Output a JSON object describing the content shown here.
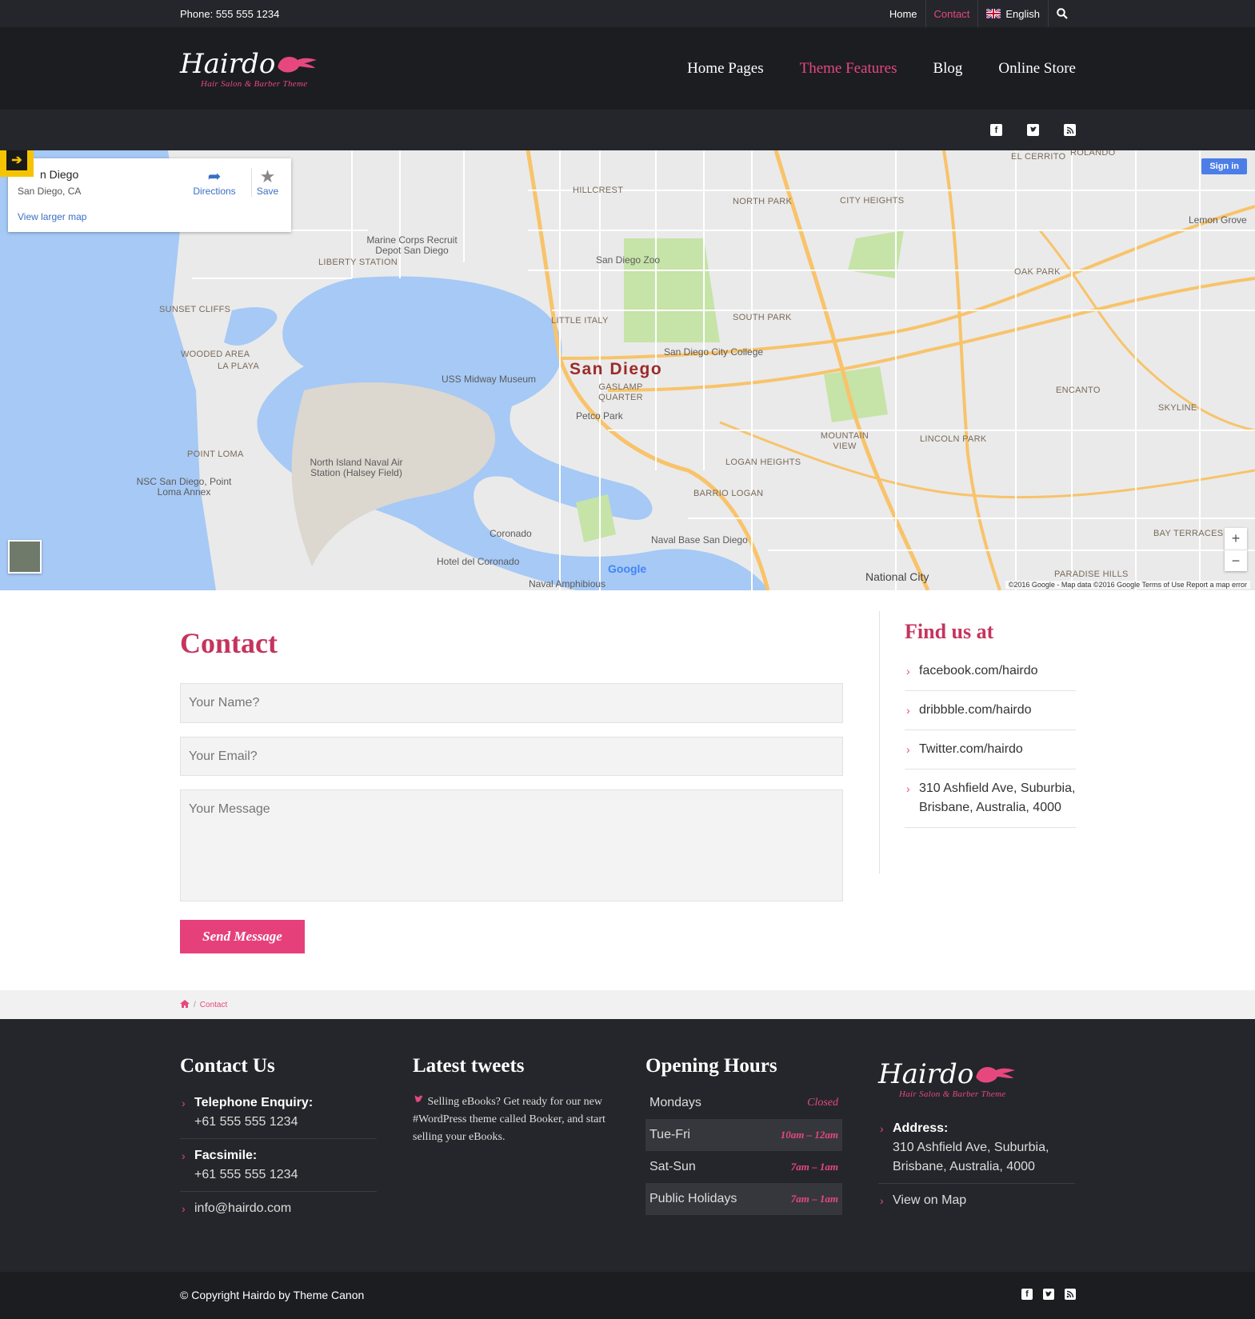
{
  "topbar": {
    "phone": "Phone: 555 555 1234",
    "links": [
      "Home",
      "Contact",
      "English"
    ]
  },
  "header": {
    "logo_text": "Hairdo",
    "logo_tagline": "Hair Salon & Barber Theme",
    "nav": [
      "Home Pages",
      "Theme Features",
      "Blog",
      "Online Store"
    ]
  },
  "map": {
    "place_title": "n Diego",
    "place_sub": "San Diego, CA",
    "larger_map": "View larger map",
    "directions": "Directions",
    "save": "Save",
    "sign_in": "Sign in",
    "google": "Google",
    "copyright": "©2016 Google - Map data ©2016 Google   Terms of Use   Report a map error",
    "labels": {
      "san_diego": "San Diego",
      "hillcrest": "HILLCREST",
      "north_park": "NORTH PARK",
      "city_heights": "CITY HEIGHTS",
      "el_cerrito": "EL CERRITO",
      "rolando": "ROLANDO",
      "lemon_grove": "Lemon Grove",
      "oak_park": "OAK PARK",
      "zoo": "San Diego Zoo",
      "marine": "Marine Corps Recruit Depot San Diego",
      "liberty": "LIBERTY STATION",
      "sunset": "SUNSET CLIFFS",
      "wooded": "WOODED AREA",
      "la_playa": "LA PLAYA",
      "point_loma": "POINT LOMA",
      "nsc": "NSC San Diego, Point Loma Annex",
      "little_italy": "LITTLE ITALY",
      "south_park": "SOUTH PARK",
      "city_college": "San Diego City College",
      "midway": "USS Midway Museum",
      "gaslamp": "GASLAMP QUARTER",
      "petco": "Petco Park",
      "north_island": "North Island Naval Air Station (Halsey Field)",
      "coronado": "Coronado",
      "hotel": "Hotel del Coronado",
      "naval_amph": "Naval Amphibious",
      "naval_base": "Naval Base San Diego",
      "barrio": "BARRIO LOGAN",
      "logan": "LOGAN HEIGHTS",
      "mountain": "MOUNTAIN VIEW",
      "lincoln": "LINCOLN PARK",
      "encanto": "ENCANTO",
      "skyline": "SKYLINE",
      "bay_terraces": "BAY TERRACES",
      "paradise": "PARADISE HILLS",
      "national_city": "National City"
    }
  },
  "contact": {
    "title": "Contact",
    "name_placeholder": "Your Name?",
    "email_placeholder": "Your Email?",
    "message_placeholder": "Your Message",
    "send_label": "Send Message"
  },
  "find_us": {
    "title": "Find us at",
    "items": [
      "facebook.com/hairdo",
      "dribbble.com/hairdo",
      "Twitter.com/hairdo",
      "310 Ashfield Ave, Suburbia, Brisbane, Australia, 4000"
    ]
  },
  "breadcrumb": {
    "current": "Contact"
  },
  "footer": {
    "contact_title": "Contact Us",
    "tel_label": "Telephone Enquiry:",
    "tel_value": "+61 555 555 1234",
    "fax_label": "Facsimile:",
    "fax_value": "+61 555 555 1234",
    "email": "info@hairdo.com",
    "tweets_title": "Latest tweets",
    "tweet": "Selling eBooks? Get ready for our new #WordPress theme called Booker, and start selling your eBooks.",
    "hours_title": "Opening Hours",
    "hours": [
      {
        "day": "Mondays",
        "time": "Closed"
      },
      {
        "day": "Tue-Fri",
        "time": "10am – 12am"
      },
      {
        "day": "Sat-Sun",
        "time": "7am – 1am"
      },
      {
        "day": "Public Holidays",
        "time": "7am – 1am"
      }
    ],
    "logo_text": "Hairdo",
    "logo_tagline": "Hair Salon & Barber Theme",
    "address_label": "Address:",
    "address_value": "310 Ashfield Ave, Suburbia, Brisbane, Australia, 4000",
    "view_map": "View on Map",
    "copyright": "© Copyright Hairdo by Theme Canon"
  },
  "colors": {
    "accent": "#e6487e",
    "accent_dark": "#c5345e",
    "dark": "#25262b",
    "darker": "#1c1d21"
  }
}
